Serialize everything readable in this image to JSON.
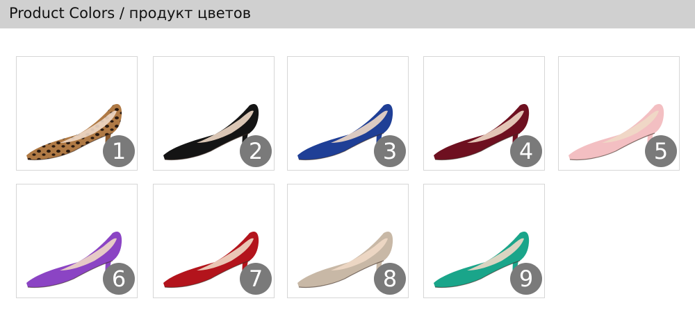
{
  "header": {
    "title": "Product Colors / продукт цветов"
  },
  "swatches": [
    {
      "number": "1",
      "color": "#8a5a2e",
      "pattern": "leopard"
    },
    {
      "number": "2",
      "color": "#141414"
    },
    {
      "number": "3",
      "color": "#1f3f96"
    },
    {
      "number": "4",
      "color": "#6e1020"
    },
    {
      "number": "5",
      "color": "#f3bfc2"
    },
    {
      "number": "6",
      "color": "#8b44c4"
    },
    {
      "number": "7",
      "color": "#b3141c"
    },
    {
      "number": "8",
      "color": "#c8b8a6"
    },
    {
      "number": "9",
      "color": "#1aa58a"
    }
  ]
}
